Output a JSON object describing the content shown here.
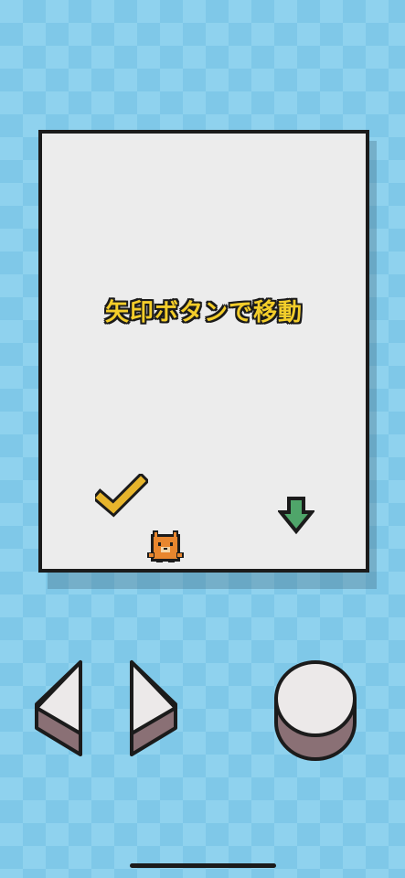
{
  "game": {
    "hint_text": "矢印ボタンで移動"
  },
  "items": {
    "checkmark_icon": "checkmark-icon",
    "down_arrow_icon": "down-arrow-icon",
    "player_icon": "fox-character-icon"
  },
  "controls": {
    "left_icon": "left-triangle-icon",
    "right_icon": "right-triangle-icon",
    "action_icon": "circle-button-icon"
  },
  "colors": {
    "background": "#8fd2ee",
    "screen": "#ececec",
    "outline": "#1b1b1b",
    "text": "#f3cd2a",
    "checkmark": "#e7b52c",
    "arrow": "#4fa56a",
    "button_top": "#ece9e9",
    "button_side": "#8a7075"
  }
}
